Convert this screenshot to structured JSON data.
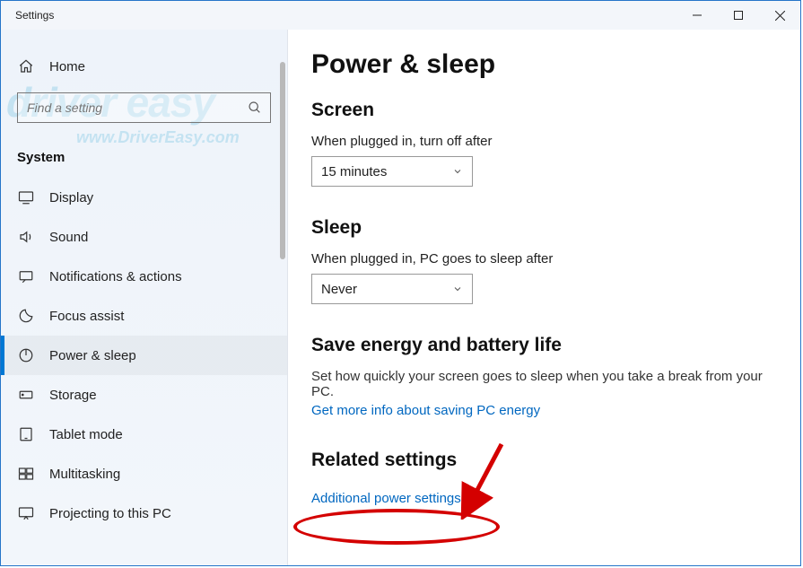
{
  "window": {
    "title": "Settings"
  },
  "sidebar": {
    "home_label": "Home",
    "search_placeholder": "Find a setting",
    "category": "System",
    "items": [
      {
        "id": "display",
        "label": "Display"
      },
      {
        "id": "sound",
        "label": "Sound"
      },
      {
        "id": "notifications",
        "label": "Notifications & actions"
      },
      {
        "id": "focus-assist",
        "label": "Focus assist"
      },
      {
        "id": "power-sleep",
        "label": "Power & sleep",
        "active": true
      },
      {
        "id": "storage",
        "label": "Storage"
      },
      {
        "id": "tablet-mode",
        "label": "Tablet mode"
      },
      {
        "id": "multitasking",
        "label": "Multitasking"
      },
      {
        "id": "projecting",
        "label": "Projecting to this PC"
      }
    ]
  },
  "content": {
    "page_title": "Power & sleep",
    "screen_heading": "Screen",
    "screen_label": "When plugged in, turn off after",
    "screen_value": "15 minutes",
    "sleep_heading": "Sleep",
    "sleep_label": "When plugged in, PC goes to sleep after",
    "sleep_value": "Never",
    "energy_heading": "Save energy and battery life",
    "energy_body": "Set how quickly your screen goes to sleep when you take a break from your PC.",
    "energy_link": "Get more info about saving PC energy",
    "related_heading": "Related settings",
    "related_link": "Additional power settings"
  },
  "watermark": {
    "main": "driver easy",
    "sub": "www.DriverEasy.com"
  },
  "colors": {
    "accent": "#0078d4",
    "link": "#0067c0",
    "annotation": "#d40000"
  }
}
